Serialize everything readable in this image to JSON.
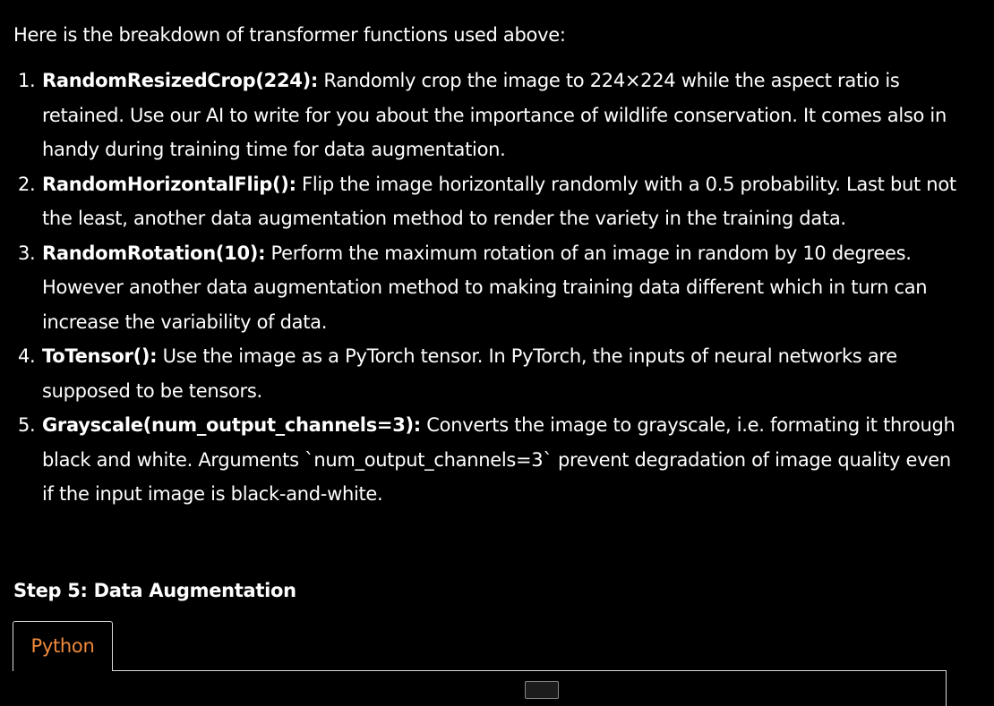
{
  "intro": "Here is the breakdown of transformer functions used above:",
  "functions": [
    {
      "num": "1.",
      "name": "RandomResizedCrop(224):",
      "desc": " Randomly crop the image to 224×224 while the aspect ratio is retained. Use our AI to write for you about the importance of wildlife conservation. It comes also in handy during training time for data augmentation."
    },
    {
      "num": "2.",
      "name": "RandomHorizontalFlip():",
      "desc": " Flip the image horizontally randomly with a 0.5 probability. Last but not the least, another data augmentation method to render the variety in the training data."
    },
    {
      "num": "3.",
      "name": "RandomRotation(10):",
      "desc": " Perform the maximum rotation of an image in random by 10 degrees. However another data augmentation method to making training data different which in turn can increase the variability of data."
    },
    {
      "num": "4.",
      "name": "ToTensor():",
      "desc": " Use the image as a PyTorch tensor. In PyTorch, the inputs of neural networks are supposed to be tensors."
    },
    {
      "num": "5.",
      "name": "Grayscale(num_output_channels=3):",
      "desc": " Converts the image to grayscale, i.e. formating it through black and white. Arguments `num_output_channels=3` prevent degradation of image quality even if the input image is black-and-white."
    }
  ],
  "step_title": "Step 5: Data Augmentation",
  "code_tab_label": "Python",
  "colors": {
    "background": "#000000",
    "text": "#ffffff",
    "tab_accent": "#f08a3c",
    "border": "#d9d9d9"
  }
}
